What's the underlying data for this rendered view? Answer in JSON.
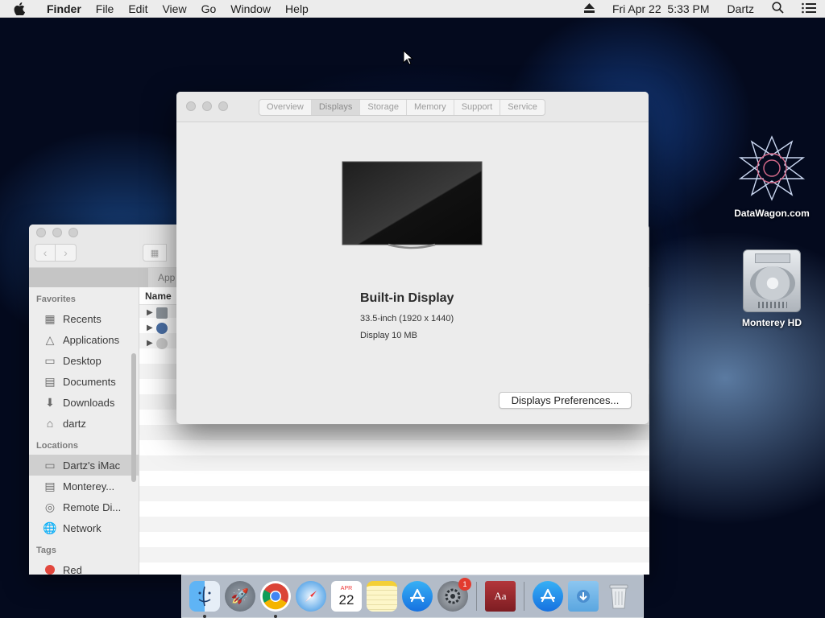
{
  "menubar": {
    "app_name": "Finder",
    "menus": [
      "File",
      "Edit",
      "View",
      "Go",
      "Window",
      "Help"
    ],
    "datetime": "Fri Apr 22  5:33 PM",
    "user": "Dartz",
    "icons": [
      "apple-icon",
      "eject-icon",
      "spotlight-icon",
      "notification-center-icon"
    ]
  },
  "finder": {
    "path_tab": "App",
    "column_name": "Name",
    "sidebar": {
      "favorites_heading": "Favorites",
      "favorites": [
        {
          "label": "Recents",
          "icon": "clock-icon"
        },
        {
          "label": "Applications",
          "icon": "applications-icon"
        },
        {
          "label": "Desktop",
          "icon": "desktop-icon"
        },
        {
          "label": "Documents",
          "icon": "document-icon"
        },
        {
          "label": "Downloads",
          "icon": "download-icon"
        },
        {
          "label": "dartz",
          "icon": "home-icon"
        }
      ],
      "locations_heading": "Locations",
      "locations": [
        {
          "label": "Dartz's iMac",
          "icon": "imac-icon"
        },
        {
          "label": "Monterey...",
          "icon": "drive-icon"
        },
        {
          "label": "Remote Di...",
          "icon": "disc-icon"
        },
        {
          "label": "Network",
          "icon": "network-icon"
        }
      ],
      "tags_heading": "Tags",
      "tags": [
        {
          "label": "Red",
          "color": "#e2473d"
        }
      ]
    }
  },
  "about": {
    "tabs": [
      "Overview",
      "Displays",
      "Storage",
      "Memory",
      "Support",
      "Service"
    ],
    "active_tab": "Displays",
    "display_name": "Built-in Display",
    "display_size": "33.5-inch (1920 x 1440)",
    "display_memory": "Display 10 MB",
    "preferences_button": "Displays Preferences..."
  },
  "desktop_icons": [
    {
      "label": "DataWagon.com"
    },
    {
      "label": "Monterey HD"
    }
  ],
  "dock": {
    "calendar_month": "APR",
    "calendar_day": "22",
    "system_prefs_badge": "1",
    "items": [
      "finder",
      "launchpad",
      "chrome",
      "safari",
      "calendar",
      "notes",
      "app-store",
      "system-preferences",
      "dictionary",
      "app-store-downloads",
      "downloads-folder",
      "trash"
    ]
  }
}
